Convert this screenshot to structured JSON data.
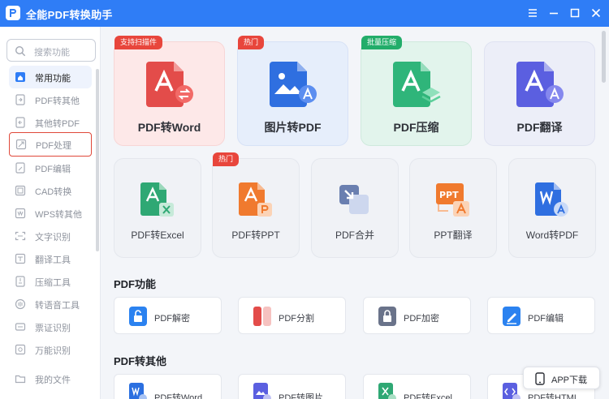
{
  "app": {
    "title": "全能PDF转换助手"
  },
  "sidebar": {
    "search_placeholder": "搜索功能",
    "items": [
      {
        "label": "常用功能",
        "icon": "home-icon"
      },
      {
        "label": "PDF转其他",
        "icon": "pdf-export-icon"
      },
      {
        "label": "其他转PDF",
        "icon": "pdf-import-icon"
      },
      {
        "label": "PDF处理",
        "icon": "pdf-process-icon"
      },
      {
        "label": "PDF编辑",
        "icon": "pdf-edit-icon"
      },
      {
        "label": "CAD转换",
        "icon": "cad-icon"
      },
      {
        "label": "WPS转其他",
        "icon": "wps-icon"
      },
      {
        "label": "文字识别",
        "icon": "ocr-icon"
      },
      {
        "label": "翻译工具",
        "icon": "translate-icon"
      },
      {
        "label": "压缩工具",
        "icon": "compress-icon"
      },
      {
        "label": "转语音工具",
        "icon": "voice-icon"
      },
      {
        "label": "票证识别",
        "icon": "ticket-icon"
      },
      {
        "label": "万能识别",
        "icon": "scan-icon"
      },
      {
        "label": "我的文件",
        "icon": "folder-icon"
      }
    ]
  },
  "featured": [
    {
      "label": "PDF转Word",
      "tag": "支持扫描件",
      "bg": "#fde8e8",
      "tag_color": "#e8463c",
      "icon_color": "#e34c4a"
    },
    {
      "label": "图片转PDF",
      "tag": "热门",
      "bg": "#e6eefb",
      "tag_color": "#e8463c",
      "icon_color": "#2f6fe0"
    },
    {
      "label": "PDF压缩",
      "tag": "批量压缩",
      "bg": "#e2f4ec",
      "tag_color": "#22ad6a",
      "icon_color": "#2fb57a"
    },
    {
      "label": "PDF翻译",
      "tag": "",
      "bg": "#eceef8",
      "tag_color": "",
      "icon_color": "#5b5fe0"
    }
  ],
  "quick": [
    {
      "label": "PDF转Excel",
      "tag": "",
      "icon_color": "#2fa874"
    },
    {
      "label": "PDF转PPT",
      "tag": "热门",
      "icon_color": "#f07a2e"
    },
    {
      "label": "PDF合并",
      "tag": "",
      "icon_color": "#5a78b8"
    },
    {
      "label": "PPT翻译",
      "tag": "",
      "icon_color": "#f07a2e"
    },
    {
      "label": "Word转PDF",
      "tag": "",
      "icon_color": "#2f6fe0"
    }
  ],
  "sections": [
    {
      "title": "PDF功能",
      "tools": [
        {
          "label": "PDF解密",
          "icon": "unlock-icon",
          "color": "#2b82f0"
        },
        {
          "label": "PDF分割",
          "icon": "split-icon",
          "color": "#e34c4a"
        },
        {
          "label": "PDF加密",
          "icon": "lock-icon",
          "color": "#6a738a"
        },
        {
          "label": "PDF编辑",
          "icon": "edit-icon",
          "color": "#2b82f0"
        }
      ]
    },
    {
      "title": "PDF转其他",
      "tools": [
        {
          "label": "PDF转Word",
          "icon": "pdf-word-icon",
          "color": "#2b6fe0"
        },
        {
          "label": "PDF转图片",
          "icon": "pdf-image-icon",
          "color": "#5b5fe0"
        },
        {
          "label": "PDF转Excel",
          "icon": "pdf-excel-icon",
          "color": "#2fa874"
        },
        {
          "label": "PDF转HTML",
          "icon": "pdf-html-icon",
          "color": "#5b5fe0"
        }
      ]
    }
  ],
  "app_download": "APP下载"
}
